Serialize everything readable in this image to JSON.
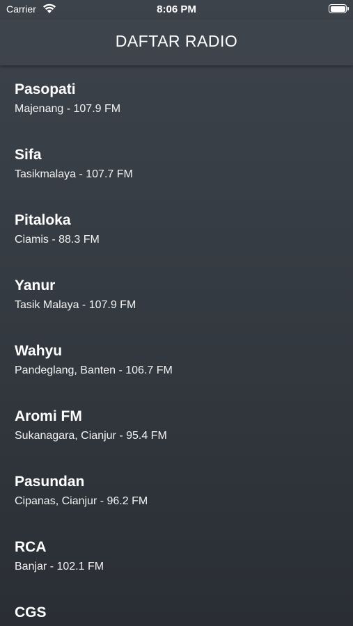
{
  "status_bar": {
    "carrier": "Carrier",
    "time": "8:06 PM",
    "wifi_icon": "wifi-icon",
    "battery_icon": "battery-icon"
  },
  "nav": {
    "title": "DAFTAR RADIO"
  },
  "stations": [
    {
      "name": "Pasopati",
      "detail": "Majenang - 107.9 FM"
    },
    {
      "name": "Sifa",
      "detail": "Tasikmalaya - 107.7 FM"
    },
    {
      "name": "Pitaloka",
      "detail": "Ciamis - 88.3 FM"
    },
    {
      "name": "Yanur",
      "detail": "Tasik Malaya - 107.9 FM"
    },
    {
      "name": "Wahyu",
      "detail": "Pandeglang, Banten - 106.7 FM"
    },
    {
      "name": "Aromi FM",
      "detail": "Sukanagara, Cianjur - 95.4 FM"
    },
    {
      "name": "Pasundan",
      "detail": "Cipanas, Cianjur - 96.2 FM"
    },
    {
      "name": "RCA",
      "detail": "Banjar - 102.1 FM"
    },
    {
      "name": "CGS",
      "detail": ""
    }
  ]
}
